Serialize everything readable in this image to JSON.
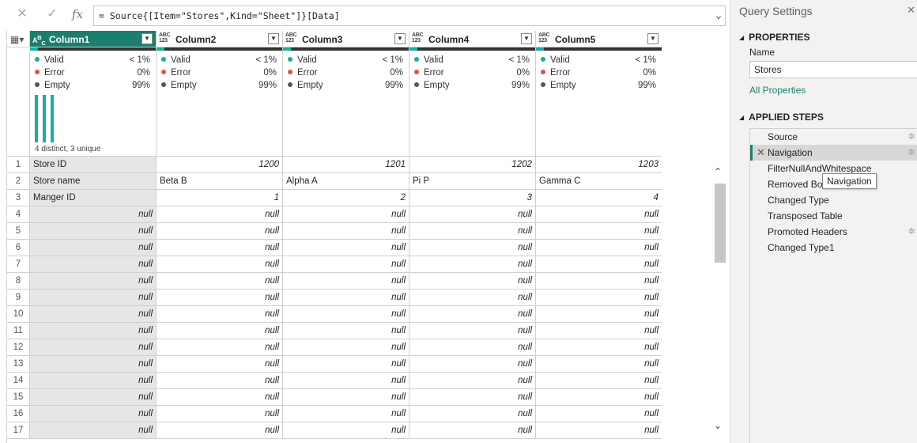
{
  "formula_bar": {
    "cancel_icon": "close-icon",
    "commit_icon": "check-icon",
    "fx_label": "fx",
    "formula": "= Source{[Item=\"Stores\",Kind=\"Sheet\"]}[Data]"
  },
  "columns": [
    {
      "name": "Column1",
      "type_top": "A",
      "type_bottom": "C",
      "type_mid": "B",
      "selected": true
    },
    {
      "name": "Column2",
      "type_top": "ABC",
      "type_bottom": "123",
      "selected": false
    },
    {
      "name": "Column3",
      "type_top": "ABC",
      "type_bottom": "123",
      "selected": false
    },
    {
      "name": "Column4",
      "type_top": "ABC",
      "type_bottom": "123",
      "selected": false
    },
    {
      "name": "Column5",
      "type_top": "ABC",
      "type_bottom": "123",
      "selected": false
    }
  ],
  "profile": {
    "labels": {
      "valid": "Valid",
      "error": "Error",
      "empty": "Empty"
    },
    "colors": {
      "valid": "#15b0a3",
      "error": "#e0524a",
      "empty": "#555555"
    },
    "columns": [
      {
        "valid": "< 1%",
        "error": "0%",
        "empty": "99%",
        "distinct": "4 distinct, 3 unique"
      },
      {
        "valid": "< 1%",
        "error": "0%",
        "empty": "99%"
      },
      {
        "valid": "< 1%",
        "error": "0%",
        "empty": "99%"
      },
      {
        "valid": "< 1%",
        "error": "0%",
        "empty": "99%"
      },
      {
        "valid": "< 1%",
        "error": "0%",
        "empty": "99%"
      }
    ]
  },
  "rows": [
    {
      "n": "1",
      "cells": [
        "Store ID",
        "1200",
        "1201",
        "1202",
        "1203"
      ]
    },
    {
      "n": "2",
      "cells": [
        "Store name",
        "Beta B",
        "Alpha A",
        "Pi P",
        "Gamma C"
      ]
    },
    {
      "n": "3",
      "cells": [
        "Manger ID",
        "1",
        "2",
        "3",
        "4"
      ]
    },
    {
      "n": "4",
      "cells": [
        "null",
        "null",
        "null",
        "null",
        "null"
      ]
    },
    {
      "n": "5",
      "cells": [
        "null",
        "null",
        "null",
        "null",
        "null"
      ]
    },
    {
      "n": "6",
      "cells": [
        "null",
        "null",
        "null",
        "null",
        "null"
      ]
    },
    {
      "n": "7",
      "cells": [
        "null",
        "null",
        "null",
        "null",
        "null"
      ]
    },
    {
      "n": "8",
      "cells": [
        "null",
        "null",
        "null",
        "null",
        "null"
      ]
    },
    {
      "n": "9",
      "cells": [
        "null",
        "null",
        "null",
        "null",
        "null"
      ]
    },
    {
      "n": "10",
      "cells": [
        "null",
        "null",
        "null",
        "null",
        "null"
      ]
    },
    {
      "n": "11",
      "cells": [
        "null",
        "null",
        "null",
        "null",
        "null"
      ]
    },
    {
      "n": "12",
      "cells": [
        "null",
        "null",
        "null",
        "null",
        "null"
      ]
    },
    {
      "n": "13",
      "cells": [
        "null",
        "null",
        "null",
        "null",
        "null"
      ]
    },
    {
      "n": "14",
      "cells": [
        "null",
        "null",
        "null",
        "null",
        "null"
      ]
    },
    {
      "n": "15",
      "cells": [
        "null",
        "null",
        "null",
        "null",
        "null"
      ]
    },
    {
      "n": "16",
      "cells": [
        "null",
        "null",
        "null",
        "null",
        "null"
      ]
    },
    {
      "n": "17",
      "cells": [
        "null",
        "null",
        "null",
        "null",
        "null"
      ]
    }
  ],
  "query_settings": {
    "title": "Query Settings",
    "properties_heading": "PROPERTIES",
    "name_label": "Name",
    "name_value": "Stores",
    "all_properties": "All Properties",
    "applied_steps_heading": "APPLIED STEPS",
    "steps": [
      {
        "label": "Source",
        "gear": true,
        "active": false
      },
      {
        "label": "Navigation",
        "gear": true,
        "active": true
      },
      {
        "label": "FilterNullAndWhitespace",
        "gear": false,
        "active": false
      },
      {
        "label": "Removed Bottom Rows",
        "gear": false,
        "active": false
      },
      {
        "label": "Changed Type",
        "gear": false,
        "active": false
      },
      {
        "label": "Transposed Table",
        "gear": false,
        "active": false
      },
      {
        "label": "Promoted Headers",
        "gear": true,
        "active": false
      },
      {
        "label": "Changed Type1",
        "gear": false,
        "active": false
      }
    ],
    "tooltip": "Navigation"
  }
}
